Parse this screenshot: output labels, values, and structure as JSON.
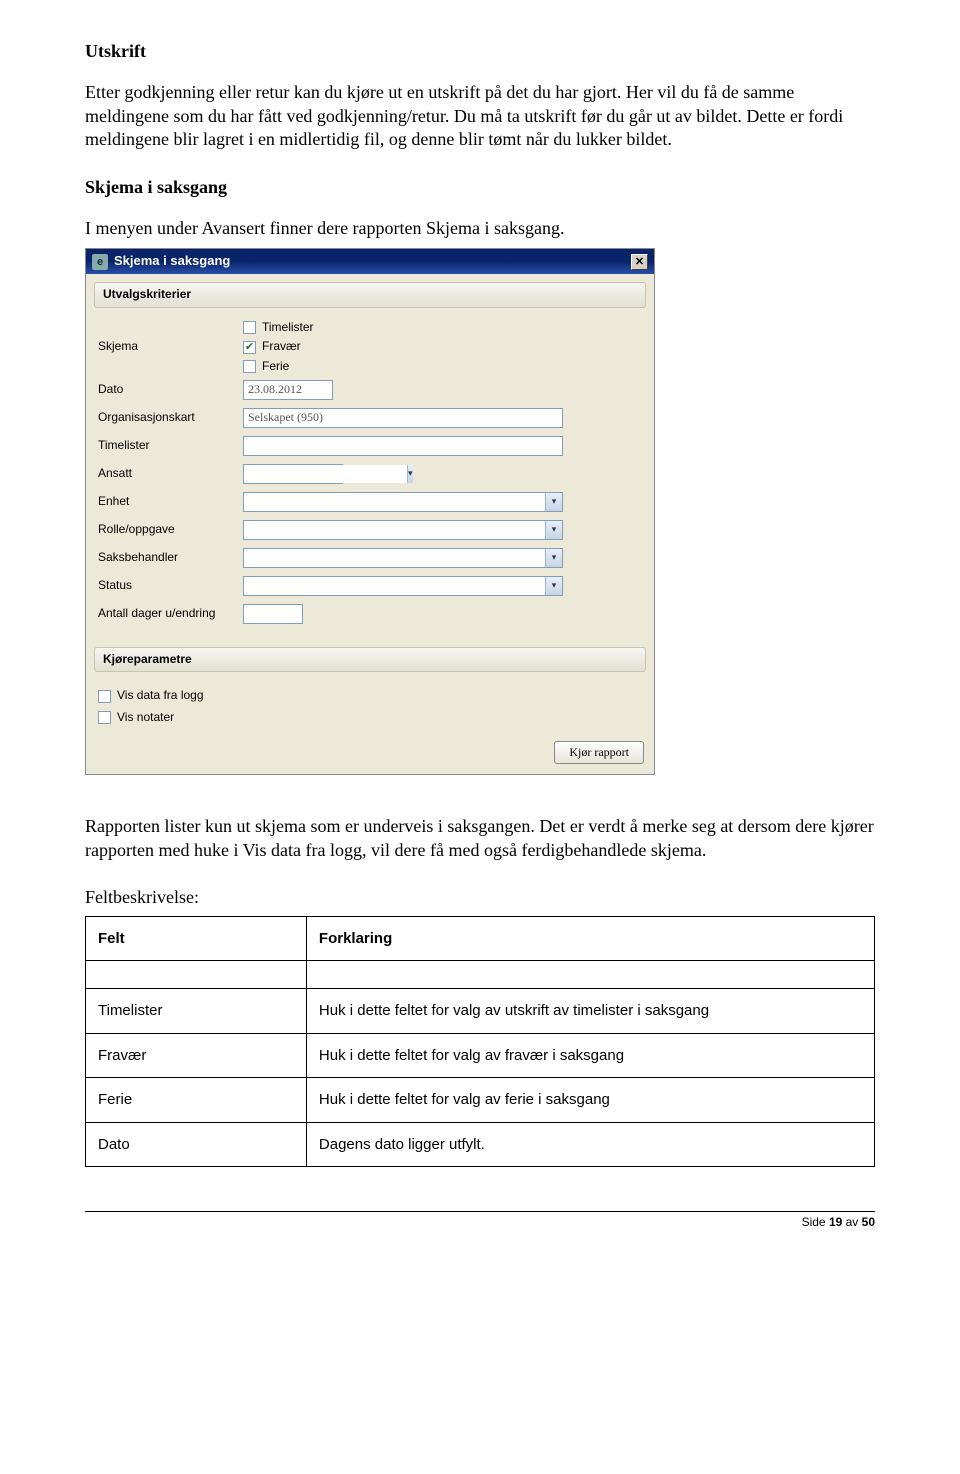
{
  "heading1": "Utskrift",
  "para1": "Etter godkjenning eller retur kan du kjøre ut en utskrift på det du har gjort. Her vil du få de samme meldingene som du har fått ved godkjenning/retur. Du må ta utskrift før du går ut av bildet. Dette er fordi meldingene blir lagret i en midlertidig fil, og denne blir tømt når du lukker bildet.",
  "heading2": "Skjema i saksgang",
  "para2": "I menyen under Avansert finner dere rapporten Skjema i saksgang.",
  "dialog": {
    "title": "Skjema i saksgang",
    "section1": "Utvalgskriterier",
    "labels": {
      "skjema": "Skjema",
      "dato": "Dato",
      "orgkart": "Organisasjonskart",
      "timelister": "Timelister",
      "ansatt": "Ansatt",
      "enhet": "Enhet",
      "rolle": "Rolle/oppgave",
      "saksbeh": "Saksbehandler",
      "status": "Status",
      "antall": "Antall dager u/endring"
    },
    "skjema_options": {
      "timelister": "Timelister",
      "fravaer": "Fravær",
      "ferie": "Ferie"
    },
    "dato_value": "23.08.2012",
    "orgkart_value": "Selskapet (950)",
    "section2": "Kjøreparametre",
    "run_opts": {
      "vislogg": "Vis data fra logg",
      "visnotater": "Vis notater"
    },
    "run_button": "Kjør rapport"
  },
  "para3": "Rapporten  lister kun ut skjema som er underveis i saksgangen. Det er verdt å merke seg at dersom dere kjører rapporten med huke i Vis data fra logg, vil dere få med også ferdigbehandlede skjema.",
  "feltbeskrivelse_label": "Feltbeskrivelse:",
  "table": {
    "h1": "Felt",
    "h2": "Forklaring",
    "rows": [
      {
        "f": "Timelister",
        "e": "Huk i dette feltet for valg av utskrift av timelister i saksgang"
      },
      {
        "f": "Fravær",
        "e": "Huk i dette feltet for valg av fravær i saksgang"
      },
      {
        "f": "Ferie",
        "e": "Huk i dette feltet for valg av ferie i saksgang"
      },
      {
        "f": "Dato",
        "e": "Dagens dato ligger utfylt."
      }
    ]
  },
  "footer": {
    "prefix": "Side ",
    "cur": "19",
    "mid": " av ",
    "total": "50"
  }
}
